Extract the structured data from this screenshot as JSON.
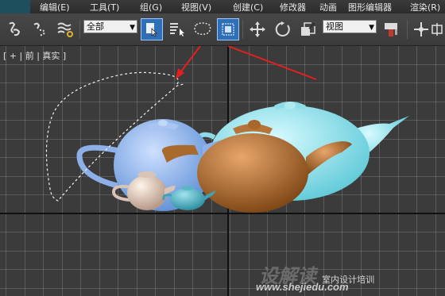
{
  "menu": {
    "items": [
      "编辑(E)",
      "工具(T)",
      "组(G)",
      "视图(V)",
      "创建(C)",
      "修改器",
      "动画",
      "图形编辑器",
      "渲染(R)"
    ]
  },
  "toolbar": {
    "filter_select": "全部",
    "view_select": "视图",
    "icons": [
      "link-icon",
      "unlink-icon",
      "bind-space-warp-icon",
      "select-object-icon",
      "select-by-name-icon",
      "lasso-selection-icon",
      "window-crossing-icon",
      "move-icon",
      "rotate-icon",
      "scale-icon",
      "pivot-center-icon",
      "snap-icon"
    ]
  },
  "viewport": {
    "label": "[ + | 前 | 真实 ]"
  },
  "watermark": {
    "brand": "设解读",
    "tagline": "室内设计培训",
    "url": "www.shejiedu.com"
  },
  "colors": {
    "viewport_bg": "#3b3b3b",
    "grid": "#8a8a8a",
    "active_tool": "#2f6fb7",
    "arrow": "#e32020"
  }
}
